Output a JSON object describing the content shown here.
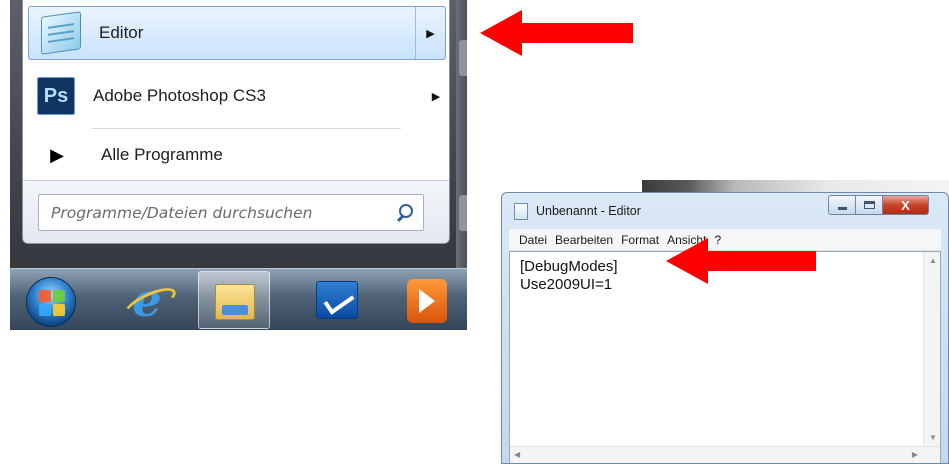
{
  "start_menu": {
    "items": [
      {
        "label": "Editor",
        "icon": "notepad-icon",
        "has_submenu": true,
        "highlighted": true
      },
      {
        "label": "Adobe Photoshop CS3",
        "icon": "photoshop-icon",
        "icon_text": "Ps",
        "has_submenu": true,
        "highlighted": false
      }
    ],
    "all_programs": "Alle Programme",
    "search_placeholder": "Programme/Dateien durchsuchen"
  },
  "taskbar": {
    "buttons": [
      "windows-start-orb",
      "internet-explorer-icon",
      "explorer-folder-icon",
      "taskbar-app-icon",
      "media-player-icon"
    ],
    "active_index": 2
  },
  "notepad": {
    "title": "Unbenannt - Editor",
    "menu": [
      "Datei",
      "Bearbeiten",
      "Format",
      "Ansicht",
      "?"
    ],
    "content_lines": [
      "[DebugModes]",
      "Use2009UI=1"
    ],
    "close_label": "X"
  },
  "annotations": {
    "arrow_color": "#ff0000"
  }
}
